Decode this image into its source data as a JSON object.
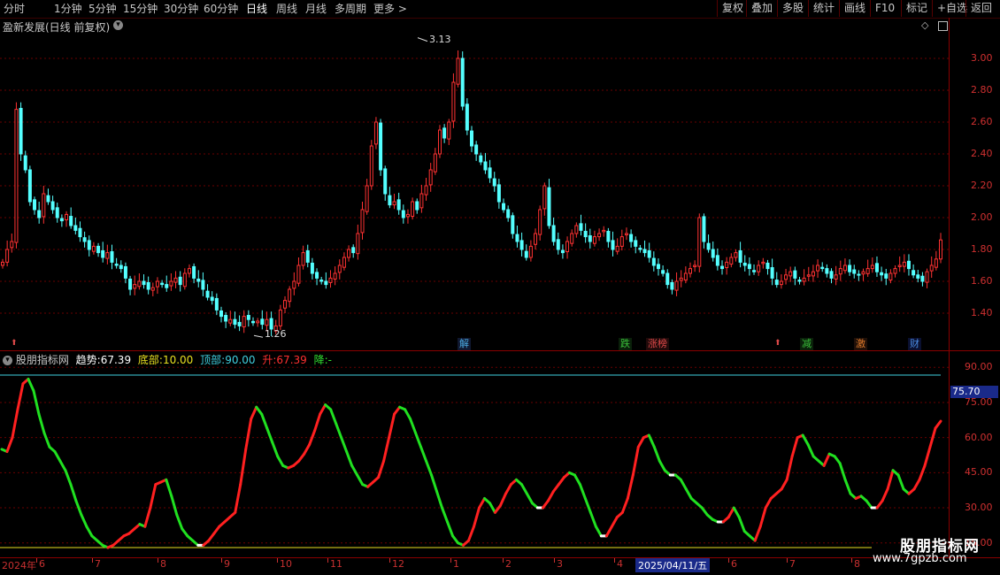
{
  "toolbar": {
    "periods": [
      "分时",
      "1分钟",
      "5分钟",
      "15分钟",
      "30分钟",
      "60分钟",
      "日线",
      "周线",
      "月线",
      "多周期",
      "更多 >"
    ],
    "active_period": "日线",
    "right_buttons": [
      "复权",
      "叠加",
      "多股",
      "统计",
      "画线",
      "F10",
      "标记",
      "+自选",
      "返回"
    ]
  },
  "main_panel": {
    "title": "盈新发展(日线 前复权)",
    "y_ticks": [
      "3.00",
      "2.80",
      "2.60",
      "2.40",
      "2.20",
      "2.00",
      "1.80",
      "1.60",
      "1.40"
    ],
    "high_marker": "3.13",
    "low_marker": "1.26",
    "events": [
      {
        "label": "解",
        "color": "#4aa8e0"
      },
      {
        "label": "跌",
        "color": "#3ac03a"
      },
      {
        "label": "涨榜",
        "color": "#e04a4a"
      },
      {
        "label": "减",
        "color": "#3ac03a"
      },
      {
        "label": "激",
        "color": "#e07a2a"
      },
      {
        "label": "财",
        "color": "#4a8ae0"
      }
    ]
  },
  "indicator_panel": {
    "name": "股朋指标网",
    "trend_label": "趋势:",
    "trend_value": "67.39",
    "bottom_label": "底部:",
    "bottom_value": "10.00",
    "top_label": "顶部:",
    "top_value": "90.00",
    "up_label": "升:",
    "up_value": "67.39",
    "down_label": "降:",
    "down_value": "-",
    "y_ticks": [
      "90.00",
      "75.00",
      "60.00",
      "45.00",
      "30.00",
      "15.00"
    ],
    "current_marker": "75.70"
  },
  "x_axis": {
    "labels": [
      "2024年",
      "6",
      "7",
      "8",
      "9",
      "10",
      "11",
      "12",
      "1",
      "2",
      "3",
      "4",
      "2025/04/11/五",
      "6",
      "7",
      "8"
    ]
  },
  "watermark": {
    "line1": "股朋指标网",
    "line2": "www.7gpzb.com"
  },
  "chart_data": [
    {
      "type": "candlestick",
      "title": "盈新发展(日线 前复权)",
      "ylim": [
        1.2,
        3.2
      ],
      "close": [
        1.72,
        1.8,
        1.85,
        2.68,
        2.4,
        2.3,
        2.1,
        2.05,
        2.0,
        2.15,
        2.1,
        2.05,
        2.0,
        1.98,
        2.02,
        1.95,
        1.92,
        1.88,
        1.85,
        1.8,
        1.82,
        1.78,
        1.75,
        1.78,
        1.72,
        1.7,
        1.68,
        1.62,
        1.55,
        1.58,
        1.6,
        1.58,
        1.55,
        1.56,
        1.6,
        1.58,
        1.56,
        1.6,
        1.62,
        1.58,
        1.65,
        1.68,
        1.62,
        1.6,
        1.55,
        1.5,
        1.48,
        1.42,
        1.38,
        1.35,
        1.36,
        1.33,
        1.32,
        1.38,
        1.36,
        1.34,
        1.35,
        1.33,
        1.36,
        1.3,
        1.32,
        1.42,
        1.48,
        1.55,
        1.6,
        1.7,
        1.78,
        1.72,
        1.65,
        1.62,
        1.6,
        1.58,
        1.62,
        1.65,
        1.7,
        1.75,
        1.8,
        1.78,
        1.9,
        2.05,
        2.2,
        2.45,
        2.6,
        2.3,
        2.15,
        2.08,
        2.1,
        2.05,
        2.0,
        2.02,
        2.1,
        2.05,
        2.15,
        2.2,
        2.3,
        2.4,
        2.55,
        2.5,
        2.6,
        2.85,
        3.0,
        2.7,
        2.55,
        2.45,
        2.4,
        2.35,
        2.3,
        2.25,
        2.2,
        2.1,
        2.05,
        2.0,
        1.9,
        1.85,
        1.8,
        1.75,
        1.82,
        1.9,
        2.05,
        2.2,
        1.95,
        1.85,
        1.8,
        1.78,
        1.85,
        1.9,
        1.95,
        1.92,
        1.88,
        1.85,
        1.88,
        1.9,
        1.92,
        1.85,
        1.8,
        1.82,
        1.88,
        1.9,
        1.85,
        1.82,
        1.8,
        1.78,
        1.75,
        1.7,
        1.68,
        1.65,
        1.58,
        1.55,
        1.6,
        1.62,
        1.65,
        1.68,
        1.7,
        2.0,
        1.85,
        1.8,
        1.75,
        1.7,
        1.68,
        1.72,
        1.75,
        1.78,
        1.72,
        1.7,
        1.68,
        1.66,
        1.7,
        1.72,
        1.68,
        1.62,
        1.58,
        1.6,
        1.64,
        1.66,
        1.62,
        1.6,
        1.62,
        1.64,
        1.66,
        1.7,
        1.68,
        1.65,
        1.62,
        1.64,
        1.68,
        1.7,
        1.66,
        1.65,
        1.64,
        1.66,
        1.68,
        1.7,
        1.66,
        1.64,
        1.62,
        1.65,
        1.68,
        1.7,
        1.72,
        1.68,
        1.64,
        1.62,
        1.6,
        1.66,
        1.7,
        1.74,
        1.86
      ]
    },
    {
      "type": "line",
      "title": "股朋指标网",
      "ylim": [
        10,
        95
      ],
      "series": [
        {
          "name": "趋势",
          "values": [
            55,
            54,
            60,
            72,
            83,
            85,
            80,
            70,
            62,
            56,
            54,
            50,
            46,
            40,
            33,
            27,
            22,
            18,
            16,
            14,
            13,
            14,
            16,
            18,
            19,
            21,
            23,
            22,
            30,
            40,
            41,
            42,
            35,
            27,
            21,
            18,
            16,
            14,
            14,
            16,
            19,
            22,
            24,
            26,
            28,
            40,
            55,
            68,
            73,
            70,
            64,
            58,
            52,
            48,
            47,
            48,
            50,
            53,
            57,
            63,
            70,
            74,
            72,
            66,
            60,
            54,
            48,
            44,
            40,
            39,
            41,
            43,
            50,
            60,
            70,
            73,
            72,
            68,
            62,
            56,
            50,
            44,
            37,
            30,
            24,
            18,
            15,
            14,
            16,
            22,
            30,
            34,
            32,
            28,
            31,
            36,
            40,
            42,
            40,
            36,
            32,
            30,
            30,
            33,
            37,
            40,
            43,
            45,
            44,
            40,
            34,
            28,
            22,
            18,
            18,
            22,
            26,
            28,
            34,
            44,
            56,
            60,
            61,
            56,
            50,
            46,
            44,
            44,
            42,
            38,
            34,
            32,
            30,
            27,
            25,
            24,
            24,
            26,
            30,
            26,
            20,
            18,
            16,
            22,
            30,
            34,
            36,
            38,
            42,
            52,
            60,
            61,
            57,
            52,
            50,
            48,
            53,
            52,
            49,
            42,
            36,
            34,
            35,
            33,
            30,
            30,
            33,
            38,
            46,
            44,
            38,
            36,
            38,
            42,
            48,
            56,
            64,
            67
          ]
        }
      ]
    }
  ]
}
